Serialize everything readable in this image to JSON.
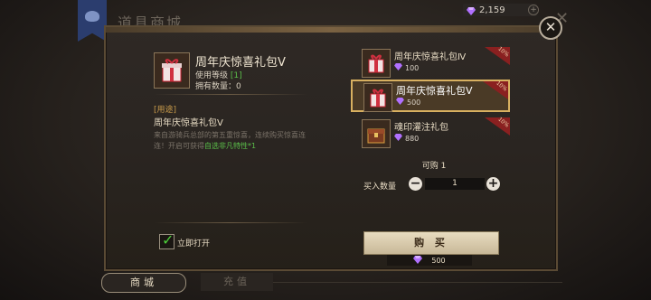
{
  "window": {
    "title": "道具商城"
  },
  "currency": {
    "gems": "2,159",
    "add": "+"
  },
  "selected": {
    "name": "周年庆惊喜礼包Ⅴ",
    "level_label": "使用等级",
    "level_value": "[1]",
    "own_label": "拥有数量：0"
  },
  "usage": {
    "label": "[用途]",
    "name": "周年庆惊喜礼包Ⅴ",
    "desc_a": "来自游骑兵总部的第五重惊喜，连续购买惊喜连连！开启可获得",
    "desc_hl": "自选非凡特性*1"
  },
  "open_now": {
    "label": "立即打开",
    "checked": true
  },
  "items": [
    {
      "name": "周年庆惊喜礼包Ⅳ",
      "price": "100",
      "tag": "10%",
      "icon": "gift-box-icon"
    },
    {
      "name": "周年庆惊喜礼包Ⅴ",
      "price": "500",
      "tag": "10%",
      "icon": "gift-box-icon"
    },
    {
      "name": "魂印灌注礼包",
      "price": "880",
      "tag": "10%",
      "icon": "chest-icon"
    }
  ],
  "buyable": "可购 1",
  "quantity": {
    "label": "买入数量",
    "value": "1",
    "minus": "−",
    "plus": "+"
  },
  "buy": {
    "label": "购 买",
    "cost": "500"
  },
  "tabs": {
    "shop": "商城",
    "recharge": "充值"
  },
  "colors": {
    "accent_gold": "#d8b060",
    "gem_purple": "#b070ff",
    "highlight_green": "#5bbf4a"
  }
}
